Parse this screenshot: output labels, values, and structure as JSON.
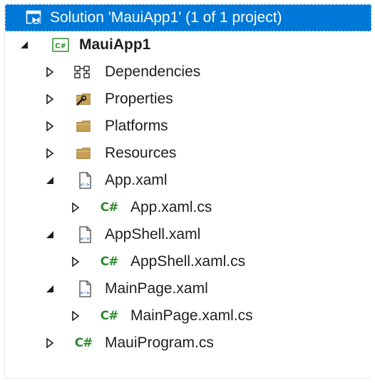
{
  "colors": {
    "selection": "#0078d7",
    "folder": "#c8a154",
    "csharp": "#2e8b2e",
    "text": "#1e1e1e"
  },
  "tree": [
    {
      "label": "Solution 'MauiApp1' (1 of 1 project)",
      "icon": "solution-icon",
      "expander": "none",
      "selected": true
    },
    {
      "label": "MauiApp1",
      "icon": "csharp-project-icon",
      "expander": "expanded",
      "bold": true
    },
    {
      "label": "Dependencies",
      "icon": "dependencies-icon",
      "expander": "collapsed"
    },
    {
      "label": "Properties",
      "icon": "properties-folder-icon",
      "expander": "collapsed"
    },
    {
      "label": "Platforms",
      "icon": "folder-icon",
      "expander": "collapsed"
    },
    {
      "label": "Resources",
      "icon": "folder-icon",
      "expander": "collapsed"
    },
    {
      "label": "App.xaml",
      "icon": "xaml-file-icon",
      "expander": "expanded"
    },
    {
      "label": "App.xaml.cs",
      "icon": "csharp-file-icon",
      "expander": "collapsed"
    },
    {
      "label": "AppShell.xaml",
      "icon": "xaml-file-icon",
      "expander": "expanded"
    },
    {
      "label": "AppShell.xaml.cs",
      "icon": "csharp-file-icon",
      "expander": "collapsed"
    },
    {
      "label": "MainPage.xaml",
      "icon": "xaml-file-icon",
      "expander": "expanded"
    },
    {
      "label": "MainPage.xaml.cs",
      "icon": "csharp-file-icon",
      "expander": "collapsed"
    },
    {
      "label": "MauiProgram.cs",
      "icon": "csharp-file-icon",
      "expander": "collapsed"
    }
  ]
}
